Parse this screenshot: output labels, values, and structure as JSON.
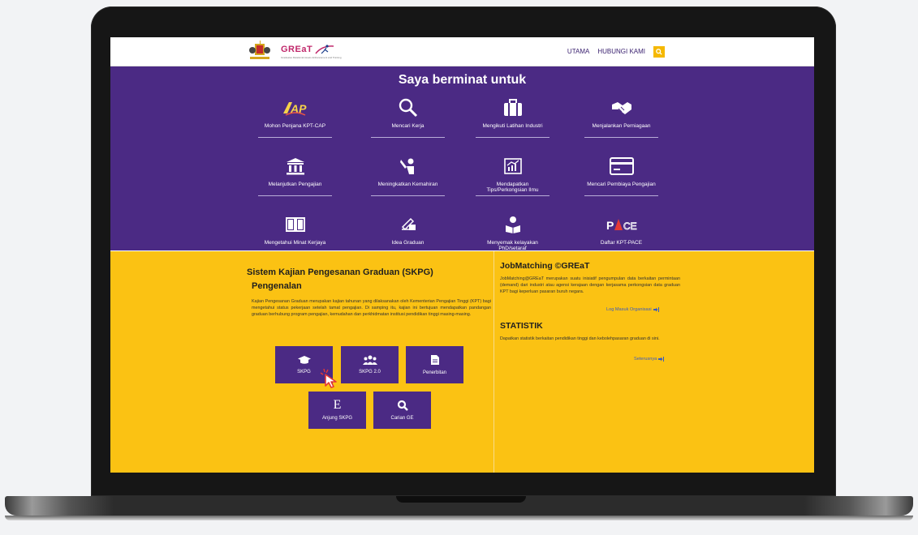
{
  "header": {
    "logo_brand": "GREaT",
    "logo_sub": "Graduates Relational Assets Enhancement and Training",
    "ministry": "KEMENTERIAN PENGAJIAN TINGGI",
    "nav": [
      "UTAMA",
      "HUBUNGI KAMI"
    ]
  },
  "interest": {
    "title": "Saya berminat untuk",
    "items": [
      {
        "label": "Mohon Penjana KPT-CAP",
        "icon": "kpt-cap-logo-icon"
      },
      {
        "label": "Mencari Kerja",
        "icon": "magnifier-icon"
      },
      {
        "label": "Mengikuti Latihan Industri",
        "icon": "briefcase-icon"
      },
      {
        "label": "Menjalankan Perniagaan",
        "icon": "handshake-icon"
      },
      {
        "label": "Melanjutkan Pengajian",
        "icon": "institution-icon"
      },
      {
        "label": "Meningkatkan Kemahiran",
        "icon": "worker-tools-icon"
      },
      {
        "label": "Mendapatkan Tips/Perkongsian Ilmu",
        "icon": "chart-board-icon"
      },
      {
        "label": "Mencari Pembiaya Pengajian",
        "icon": "credit-card-icon"
      },
      {
        "label": "Mengetahui Minat Kerjaya",
        "icon": "open-book-icon"
      },
      {
        "label": "Idea Graduan",
        "icon": "hand-writing-icon"
      },
      {
        "label": "Menyemak kelayakan PhD/setaraf",
        "icon": "reader-icon"
      },
      {
        "label": "Daftar KPT-PACE",
        "icon": "kpt-pace-logo-icon"
      }
    ]
  },
  "skpg": {
    "title": "Sistem Kajian Pengesanan Graduan (SKPG)",
    "intro_heading": "Pengenalan",
    "intro_text": "Kajian Pengesanan Graduan merupakan kajian tahunan yang dilaksanakan oleh Kementerian Pengajian Tinggi (KPT) bagi mengetahui status pekerjaan setelah tamat pengajian. Di samping itu, kajian ini bertujuan mendapatkan pandangan graduan berhubung program pengajian, kemudahan dan perkhidmatan institusi pendidikan tinggi masing-masing.",
    "buttons": [
      {
        "label": "SKPG",
        "icon": "graduation-cap-icon"
      },
      {
        "label": "SKPG 2.0",
        "icon": "users-icon"
      },
      {
        "label": "Penerbitan",
        "icon": "document-icon"
      },
      {
        "label": "Anjung SKPG",
        "icon": "letter-e-icon"
      },
      {
        "label": "Carian GE",
        "icon": "search-icon"
      }
    ],
    "anjung_glyph": "E"
  },
  "jobmatching": {
    "title": "JobMatching ©GREaT",
    "text": "JobMatching@GREaT merupakan suatu inisiatif pengumpulan data berkaitan permintaan (demand) dari industri atau agensi kerajaan dengan kerjasama perkongsian data graduan KPT bagi keperluan pasaran buruh negara.",
    "link": "Log Masuk Organisasi"
  },
  "statistik": {
    "title": "STATISTIK",
    "text": "Dapatkan statistik berkaitan pendidikan tinggi dan kebolehpasaran graduan di sini.",
    "link": "Seterusnya"
  },
  "colors": {
    "purple": "#4b2a84",
    "yellow": "#fbc213",
    "accent": "#f5b800"
  }
}
